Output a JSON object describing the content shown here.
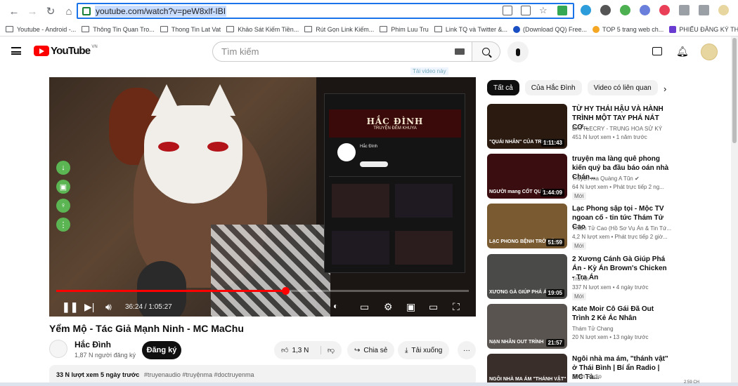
{
  "browser": {
    "url": "youtube.com/watch?v=peW8xlf-IBI",
    "bookmarks": [
      "Youtube - Android -...",
      "Thông Tin Quan Tro...",
      "Thong Tin Lat Vat",
      "Khảo Sát Kiếm Tiền...",
      "Rút Gọn Link Kiếm...",
      "Phim Luu Tru",
      "Link TQ và Twitter &...",
      "(Download QQ) Free...",
      "TOP 5 trang web ch...",
      "PHIẾU ĐĂNG KÝ TH..."
    ],
    "bookmarks_more": "»"
  },
  "header": {
    "logo_text": "YouTube",
    "logo_region": "VN",
    "search_placeholder": "Tìm kiếm"
  },
  "player": {
    "ad_tag": "Tải video này",
    "time": "36:24 / 1:05:27",
    "progress": 0.556,
    "phone_banner_title": "HẮC ĐÌNH",
    "phone_banner_sub": "TRUYỆN ĐÊM KHUYA",
    "phone_channel": "Hắc Đình"
  },
  "video": {
    "title": "Yểm Mộ - Tác Giả Mạnh Ninh - MC MaChu",
    "channel": "Hắc Đình",
    "subs": "1,87 N người đăng ký",
    "subscribe_label": "Đăng ký",
    "likes": "1,3 N",
    "share_label": "Chia sẻ",
    "download_label": "Tải xuống",
    "more_label": "···",
    "views_date": "33 N lượt xem  5 ngày trước",
    "tags": "#truyenaudio #truyệnma #doctruyenma"
  },
  "chips": [
    "Tất cả",
    "Của Hắc Đình",
    "Video có liên quan"
  ],
  "chip_next": "›",
  "recommendations": [
    {
      "title": "TỪ HY THÁI HẬU VÀ HÀNH TRÌNH MỘT TAY PHÁ NÁT CƠ...",
      "channel": "BATTLECRY - TRUNG HOA SỬ KÝ",
      "meta": "451 N lượt xem  • 1 năm trước",
      "duration": "1:11:43",
      "badge": "",
      "overlay": "\"QUÁI NHÂN\" CỦA TRUNG HO",
      "color": "#2a1a10"
    },
    {
      "title": "truyện ma làng quê phong kiến quỷ ba đầu báo oán nhà Chán...",
      "channel": "Truyện ma Quàng A Tũn ✔",
      "meta": "64 N lượt xem  • Phát trực tiếp 2 ng...",
      "duration": "1:44:09",
      "badge": "Mới",
      "overlay": "NGƯỜI mang CỐT QUỶ",
      "color": "#3a0e10"
    },
    {
      "title": "Lạc Phong sập tọi - Mộc TV ngoan cố - tin tức Thám Tử Cao",
      "channel": "Thám Tử Cao (Hồ Sơ Vụ Án & Tin Tứ...",
      "meta": "4,2 N lượt xem  • Phát trực tiếp 2 giờ...",
      "duration": "51:59",
      "badge": "Mới",
      "overlay": "LẠC PHONG BỆNH TRỞ NẶNG",
      "color": "#7a5a30"
    },
    {
      "title": "2 Xương Cánh Gà Giúp Phá Án - Kỳ Án Brown's Chicken - Tra Án",
      "channel": "Tra Án",
      "meta": "337 N lượt xem  • 4 ngày trước",
      "duration": "19:05",
      "badge": "Mới",
      "overlay": "XƯƠNG GÀ GIÚP PHÁ ÁN",
      "color": "#4a4a48"
    },
    {
      "title": "Kate Moir Cô Gái Đã Out Trình 2 Kẻ Ác Nhân",
      "channel": "Thám Tử Chang",
      "meta": "20 N lượt xem  • 13 ngày trước",
      "duration": "21:57",
      "badge": "",
      "overlay": "NẠN NHÂN OUT TRÌNH",
      "color": "#5a5450"
    },
    {
      "title": "Ngôi nhà ma ám, \"thánh vật\" ở Thái Bình | Bí ẩn Radio | MC Tả...",
      "channel": "Bí ẩn Radio",
      "meta": "",
      "duration": "",
      "badge": "",
      "overlay": "NGÔI NHÀ MA ÁM \"THÁNH VẬT\"",
      "color": "#3a2e2a"
    }
  ],
  "clock": "2:59 CH"
}
